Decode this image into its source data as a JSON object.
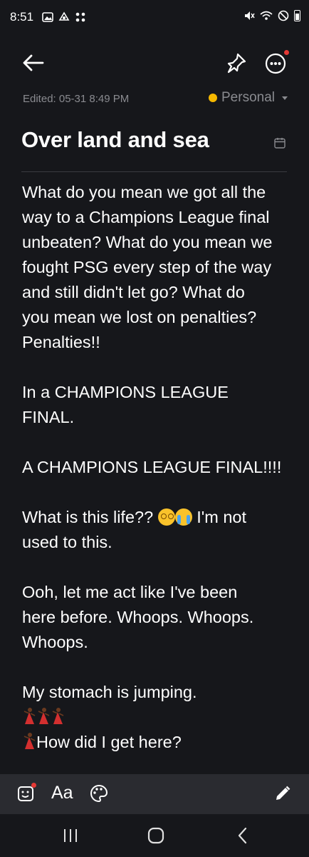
{
  "status_bar": {
    "time": "8:51",
    "left_icons": [
      "image-icon",
      "cloud-drive-icon",
      "apps-grid-icon"
    ],
    "right_icons": [
      "mute-icon",
      "wifi-icon",
      "dnd-icon",
      "battery-icon"
    ]
  },
  "toolbar": {
    "back_icon": "arrow-left-icon",
    "pin_icon": "pin-icon",
    "more_icon": "more-horizontal-icon"
  },
  "note": {
    "edited_label": "Edited: 05-31 8:49 PM",
    "category_label": "Personal",
    "category_color": "#f5b800",
    "title": "Over land and sea",
    "paragraphs": {
      "p1": "What do you mean we got all the\nway to a Champions League final\nunbeaten? What do you mean we\nfought PSG every step of the way\nand still didn't let go? What do\nyou mean we lost on penalties?\nPenalties!!",
      "p2": "In a CHAMPIONS LEAGUE\nFINAL.",
      "p3": "A CHAMPIONS LEAGUE FINAL!!!!",
      "p4_line1": "What is this life??",
      "p4_line1_end": "I'm not",
      "p4_line2": "used to this.",
      "p5": "Ooh, let me act like I've been\nhere before. Whoops. Whoops.\nWhoops.",
      "p6_line1": "My stomach is jumping.",
      "p6_line2": "How did I get here?"
    }
  },
  "bottom_toolbar": {
    "insert_icon": "image-add-icon",
    "text_style_label": "Aa",
    "palette_icon": "palette-icon",
    "pen_icon": "pencil-icon"
  },
  "nav_bar": {
    "recents_icon": "recents-icon",
    "home_icon": "home-icon",
    "back_icon": "back-chevron-icon"
  },
  "colors": {
    "background": "#16171b",
    "toolbar_bg": "#2a2b30",
    "accent_red": "#e53935",
    "muted_text": "#8a8b90"
  }
}
